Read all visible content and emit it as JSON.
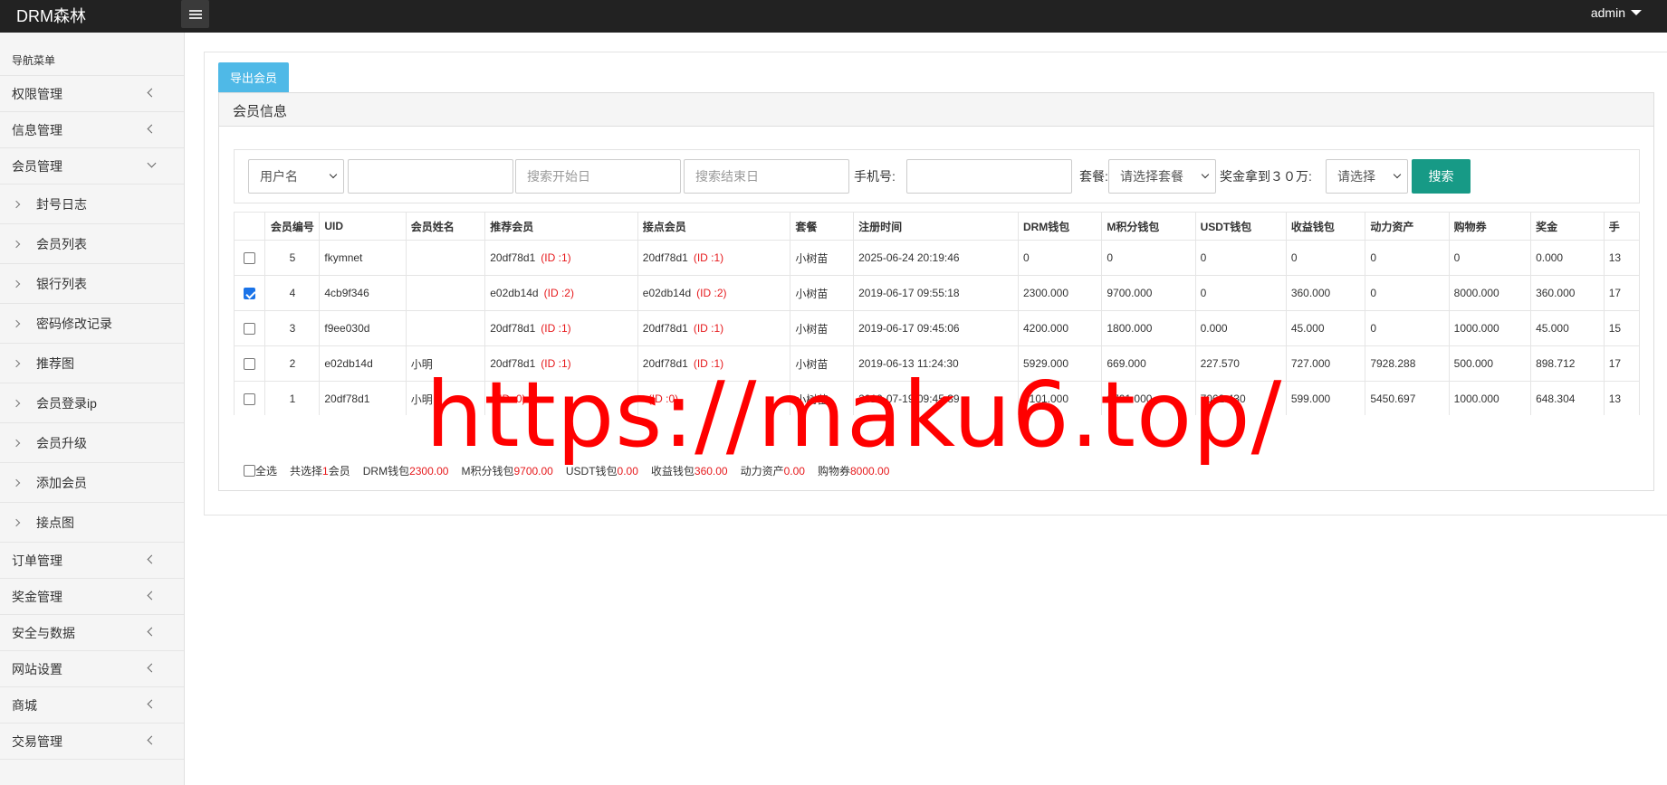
{
  "app": {
    "brand": "DRM森林",
    "user": "admin"
  },
  "sidebar": {
    "header": "导航菜单",
    "top_items": [
      {
        "label": "权限管理"
      },
      {
        "label": "信息管理"
      },
      {
        "label": "会员管理"
      }
    ],
    "sub_items": [
      {
        "label": "封号日志"
      },
      {
        "label": "会员列表"
      },
      {
        "label": "银行列表"
      },
      {
        "label": "密码修改记录"
      },
      {
        "label": "推荐图"
      },
      {
        "label": "会员登录ip"
      },
      {
        "label": "会员升级"
      },
      {
        "label": "添加会员"
      },
      {
        "label": "接点图"
      }
    ],
    "bottom_items": [
      {
        "label": "订单管理"
      },
      {
        "label": "奖金管理"
      },
      {
        "label": "安全与数据"
      },
      {
        "label": "网站设置"
      },
      {
        "label": "商城"
      },
      {
        "label": "交易管理"
      }
    ]
  },
  "main": {
    "export_button": "导出会员",
    "panel_title": "会员信息",
    "filter": {
      "field_select": "用户名",
      "keyword_value": "",
      "start_placeholder": "搜索开始日",
      "end_placeholder": "搜索结束日",
      "phone_label": "手机号:",
      "phone_value": "",
      "package_label": "套餐:",
      "package_select": "请选择套餐",
      "bonus_label": "奖金拿到３０万:",
      "bonus_select": "请选择",
      "search_button": "搜索"
    },
    "table": {
      "headers": [
        "",
        "会员编号",
        "UID",
        "会员姓名",
        "推荐会员",
        "接点会员",
        "套餐",
        "注册时间",
        "DRM钱包",
        "M积分钱包",
        "USDT钱包",
        "收益钱包",
        "动力资产",
        "购物券",
        "奖金",
        "手"
      ],
      "rows": [
        {
          "checked": false,
          "no": "5",
          "uid": "fkymnet",
          "name": "",
          "ref": "20df78d1",
          "ref_id": "(ID :1)",
          "node": "20df78d1",
          "node_id": "(ID :1)",
          "package": "小树苗",
          "reg_time": "2025-06-24 20:19:46",
          "drm": "0",
          "m": "0",
          "usdt": "0",
          "income": "0",
          "power": "0",
          "coupon": "0",
          "bonus": "0.000",
          "phone": "13"
        },
        {
          "checked": true,
          "no": "4",
          "uid": "4cb9f346",
          "name": "",
          "ref": "e02db14d",
          "ref_id": "(ID :2)",
          "node": "e02db14d",
          "node_id": "(ID :2)",
          "package": "小树苗",
          "reg_time": "2019-06-17 09:55:18",
          "drm": "2300.000",
          "m": "9700.000",
          "usdt": "0",
          "income": "360.000",
          "power": "0",
          "coupon": "8000.000",
          "bonus": "360.000",
          "phone": "17"
        },
        {
          "checked": false,
          "no": "3",
          "uid": "f9ee030d",
          "name": "",
          "ref": "20df78d1",
          "ref_id": "(ID :1)",
          "node": "20df78d1",
          "node_id": "(ID :1)",
          "package": "小树苗",
          "reg_time": "2019-06-17 09:45:06",
          "drm": "4200.000",
          "m": "1800.000",
          "usdt": "0.000",
          "income": "45.000",
          "power": "0",
          "coupon": "1000.000",
          "bonus": "45.000",
          "phone": "15"
        },
        {
          "checked": false,
          "no": "2",
          "uid": "e02db14d",
          "name": "小明",
          "ref": "20df78d1",
          "ref_id": "(ID :1)",
          "node": "20df78d1",
          "node_id": "(ID :1)",
          "package": "小树苗",
          "reg_time": "2019-06-13 11:24:30",
          "drm": "5929.000",
          "m": "669.000",
          "usdt": "227.570",
          "income": "727.000",
          "power": "7928.288",
          "coupon": "500.000",
          "bonus": "898.712",
          "phone": "17"
        },
        {
          "checked": false,
          "no": "1",
          "uid": "20df78d1",
          "name": "小明",
          "ref": "",
          "ref_id": "(ID :0)",
          "node": "",
          "node_id": "(ID :0)",
          "package": "小树苗",
          "reg_time": "2019-07-19 09:45:39",
          "drm": "5101.000",
          "m": "6701.000",
          "usdt": "7062.430",
          "income": "599.000",
          "power": "5450.697",
          "coupon": "1000.000",
          "bonus": "648.304",
          "phone": "13"
        }
      ]
    },
    "summary": {
      "select_all": "全选",
      "selected_prefix": "共选择",
      "selected_count": "1",
      "selected_suffix": "会员",
      "drm_label": "DRM钱包",
      "drm_value": "2300.00",
      "m_label": "M积分钱包",
      "m_value": "9700.00",
      "usdt_label": "USDT钱包",
      "usdt_value": "0.00",
      "income_label": "收益钱包",
      "income_value": "360.00",
      "power_label": "动力资产",
      "power_value": "0.00",
      "coupon_label": "购物券",
      "coupon_value": "8000.00"
    }
  },
  "watermark": "https://maku6.top/"
}
